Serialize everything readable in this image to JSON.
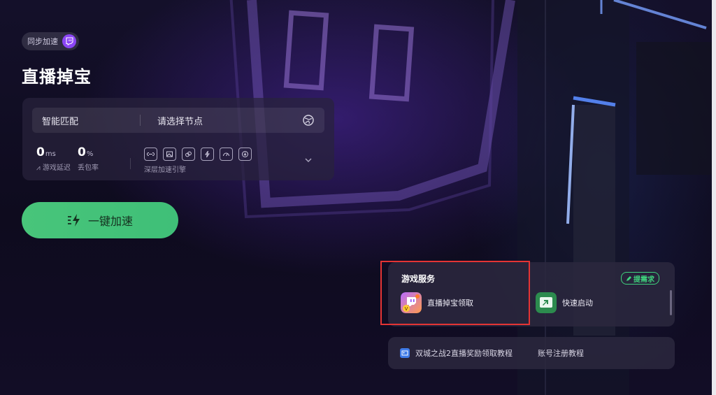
{
  "sync_chip": {
    "label": "同步加速",
    "icon": "twitch-icon"
  },
  "page_title": "直播掉宝",
  "node_panel": {
    "mode": "智能匹配",
    "node_placeholder": "请选择节点",
    "latency": {
      "value": "0",
      "unit": "ms",
      "label": "游戏延迟"
    },
    "loss": {
      "value": "0",
      "unit": "%",
      "label": "丢包率"
    },
    "engine_label": "深层加速引擎",
    "engine_icons": [
      "link-icon",
      "image-icon",
      "chain-icon",
      "bolt-icon",
      "gauge-icon",
      "download-icon"
    ]
  },
  "boost_button": {
    "label": "一键加速",
    "color": "#48c57a"
  },
  "game_services": {
    "title": "游戏服务",
    "request_label": "提需求",
    "items": [
      {
        "label": "直播掉宝领取",
        "icon": "twitch-drops-icon"
      },
      {
        "label": "快速启动",
        "icon": "quick-launch-icon"
      }
    ]
  },
  "tutorials": {
    "items": [
      {
        "label": "双城之战2直播奖励领取教程"
      },
      {
        "label": "账号注册教程"
      }
    ]
  },
  "colors": {
    "accent_green": "#3fd27d",
    "twitch_purple": "#8b45f5",
    "highlight_red": "#e43434"
  }
}
